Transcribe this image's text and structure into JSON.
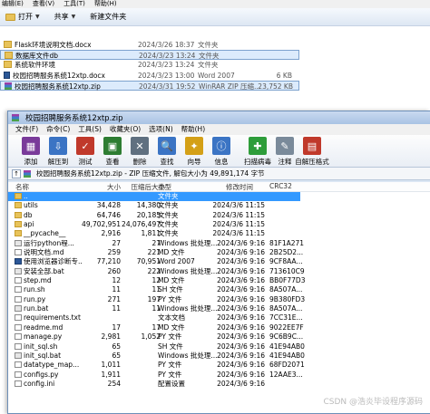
{
  "explorer": {
    "menu": [
      "编辑(E)",
      "查看(V)",
      "工具(T)",
      "帮助(H)"
    ],
    "toolbar": {
      "open": "打开",
      "share": "共享",
      "new_folder": "新建文件夹"
    },
    "files": [
      {
        "name": "Flask环境说明文档.docx",
        "date": "2024/3/26 18:37",
        "type": "文件夹",
        "size": "",
        "icon": "folder",
        "selected": false
      },
      {
        "name": "数据库文件db",
        "date": "2024/3/23 13:24",
        "type": "文件夹",
        "size": "",
        "icon": "folder",
        "selected": true
      },
      {
        "name": "系统软件环境",
        "date": "2024/3/23 13:24",
        "type": "文件夹",
        "size": "",
        "icon": "folder",
        "selected": false
      },
      {
        "name": "校园招聘服务系统12xtp.docx",
        "date": "2024/3/23 13:00",
        "type": "Word 2007",
        "size": "6 KB",
        "icon": "word",
        "selected": false
      },
      {
        "name": "校园招聘服务系统12xtp.zip",
        "date": "2024/3/31 19:52",
        "type": "WinRAR ZIP 压缩...",
        "size": "23,752 KB",
        "icon": "rar",
        "selected": true
      }
    ]
  },
  "winrar": {
    "title": "校园招聘服务系统12xtp.zip",
    "menu": [
      "文件(F)",
      "命令(C)",
      "工具(S)",
      "收藏夹(O)",
      "选项(N)",
      "帮助(H)"
    ],
    "toolbar": [
      {
        "label": "添加",
        "icon": "add-icon",
        "color": "#7a3b9a"
      },
      {
        "label": "解压到",
        "icon": "extract-to-icon",
        "color": "#3b74c4"
      },
      {
        "label": "测试",
        "icon": "test-icon",
        "color": "#c0392b"
      },
      {
        "label": "查看",
        "icon": "view-icon",
        "color": "#2e7d32"
      },
      {
        "label": "删除",
        "icon": "delete-icon",
        "color": "#607080"
      },
      {
        "label": "查找",
        "icon": "find-icon",
        "color": "#3b74c4"
      },
      {
        "label": "向导",
        "icon": "wizard-icon",
        "color": "#d4a017"
      },
      {
        "label": "信息",
        "icon": "info-icon",
        "color": "#3b74c4"
      },
      {
        "label": "扫描病毒",
        "icon": "scan-virus-icon",
        "color": "#2e9d3a"
      },
      {
        "label": "注释",
        "icon": "comment-icon",
        "color": "#7a8a9a"
      },
      {
        "label": "自解压格式",
        "icon": "sfx-icon",
        "color": "#c0392b"
      }
    ],
    "path": "校园招聘服务系统12xtp.zip - ZIP 压缩文件, 解包大小为 49,891,174 字节",
    "columns": {
      "name": "名称",
      "size": "大小",
      "packed": "压缩后大小",
      "type": "类型",
      "modified": "修改时间",
      "crc": "CRC32"
    },
    "rows": [
      {
        "name": "..",
        "size": "",
        "packed": "",
        "type": "文件夹",
        "modified": "",
        "crc": "",
        "icon": "up",
        "selected": true
      },
      {
        "name": "utils",
        "size": "34,428",
        "packed": "14,380",
        "type": "文件夹",
        "modified": "2024/3/6 11:15",
        "crc": "",
        "icon": "folder",
        "selected": false
      },
      {
        "name": "db",
        "size": "64,746",
        "packed": "20,185",
        "type": "文件夹",
        "modified": "2024/3/6 11:15",
        "crc": "",
        "icon": "folder",
        "selected": false
      },
      {
        "name": "api",
        "size": "49,702,951",
        "packed": "24,076,497",
        "type": "文件夹",
        "modified": "2024/3/6 11:15",
        "crc": "",
        "icon": "folder",
        "selected": false
      },
      {
        "name": "__pycache__",
        "size": "2,916",
        "packed": "1,811",
        "type": "文件夹",
        "modified": "2024/3/6 11:15",
        "crc": "",
        "icon": "folder",
        "selected": false
      },
      {
        "name": "运行python程...",
        "size": "27",
        "packed": "27",
        "type": "Windows 批处理...",
        "modified": "2024/3/6 9:16",
        "crc": "81F1A271",
        "icon": "bat",
        "selected": false
      },
      {
        "name": "说明文档.md",
        "size": "259",
        "packed": "221",
        "type": "MD 文件",
        "modified": "2024/3/6 9:16",
        "crc": "2B25D2...",
        "icon": "md",
        "selected": false
      },
      {
        "name": "使用浏览器诊断专...",
        "size": "77,210",
        "packed": "70,951",
        "type": "Word 2007",
        "modified": "2024/3/6 9:16",
        "crc": "9CF8AA...",
        "icon": "word",
        "selected": false
      },
      {
        "name": "安装全部.bat",
        "size": "260",
        "packed": "222",
        "type": "Windows 批处理...",
        "modified": "2024/3/6 9:16",
        "crc": "713610C9",
        "icon": "bat",
        "selected": false
      },
      {
        "name": "step.md",
        "size": "12",
        "packed": "12",
        "type": "MD 文件",
        "modified": "2024/3/6 9:16",
        "crc": "BB0F77D3",
        "icon": "md",
        "selected": false
      },
      {
        "name": "run.sh",
        "size": "11",
        "packed": "11",
        "type": "SH 文件",
        "modified": "2024/3/6 9:16",
        "crc": "8A507A...",
        "icon": "md",
        "selected": false
      },
      {
        "name": "run.py",
        "size": "271",
        "packed": "197",
        "type": "PY 文件",
        "modified": "2024/3/6 9:16",
        "crc": "9B380FD3",
        "icon": "md",
        "selected": false
      },
      {
        "name": "run.bat",
        "size": "11",
        "packed": "11",
        "type": "Windows 批处理...",
        "modified": "2024/3/6 9:16",
        "crc": "8A507A...",
        "icon": "bat",
        "selected": false
      },
      {
        "name": "requirements.txt",
        "size": "",
        "packed": "",
        "type": "文本文档",
        "modified": "2024/3/6 9:16",
        "crc": "7CC31E...",
        "icon": "md",
        "selected": false
      },
      {
        "name": "readme.md",
        "size": "17",
        "packed": "17",
        "type": "MD 文件",
        "modified": "2024/3/6 9:16",
        "crc": "9022EE7F",
        "icon": "md",
        "selected": false
      },
      {
        "name": "manage.py",
        "size": "2,981",
        "packed": "1,052",
        "type": "PY 文件",
        "modified": "2024/3/6 9:16",
        "crc": "9C6B9C...",
        "icon": "md",
        "selected": false
      },
      {
        "name": "init_sql.sh",
        "size": "65",
        "packed": "",
        "type": "SH 文件",
        "modified": "2024/3/6 9:16",
        "crc": "41E94AB0",
        "icon": "md",
        "selected": false
      },
      {
        "name": "init_sql.bat",
        "size": "65",
        "packed": "",
        "type": "Windows 批处理...",
        "modified": "2024/3/6 9:16",
        "crc": "41E94AB0",
        "icon": "bat",
        "selected": false
      },
      {
        "name": "datatype_map...",
        "size": "1,011",
        "packed": "",
        "type": "PY 文件",
        "modified": "2024/3/6 9:16",
        "crc": "68FD2071",
        "icon": "md",
        "selected": false
      },
      {
        "name": "configs.py",
        "size": "1,911",
        "packed": "",
        "type": "PY 文件",
        "modified": "2024/3/6 9:16",
        "crc": "12AAE3...",
        "icon": "md",
        "selected": false
      },
      {
        "name": "config.ini",
        "size": "254",
        "packed": "",
        "type": "配置设置",
        "modified": "2024/3/6 9:16",
        "crc": "",
        "icon": "md",
        "selected": false
      }
    ]
  },
  "watermark": "CSDN @浩炎毕设程序源码"
}
